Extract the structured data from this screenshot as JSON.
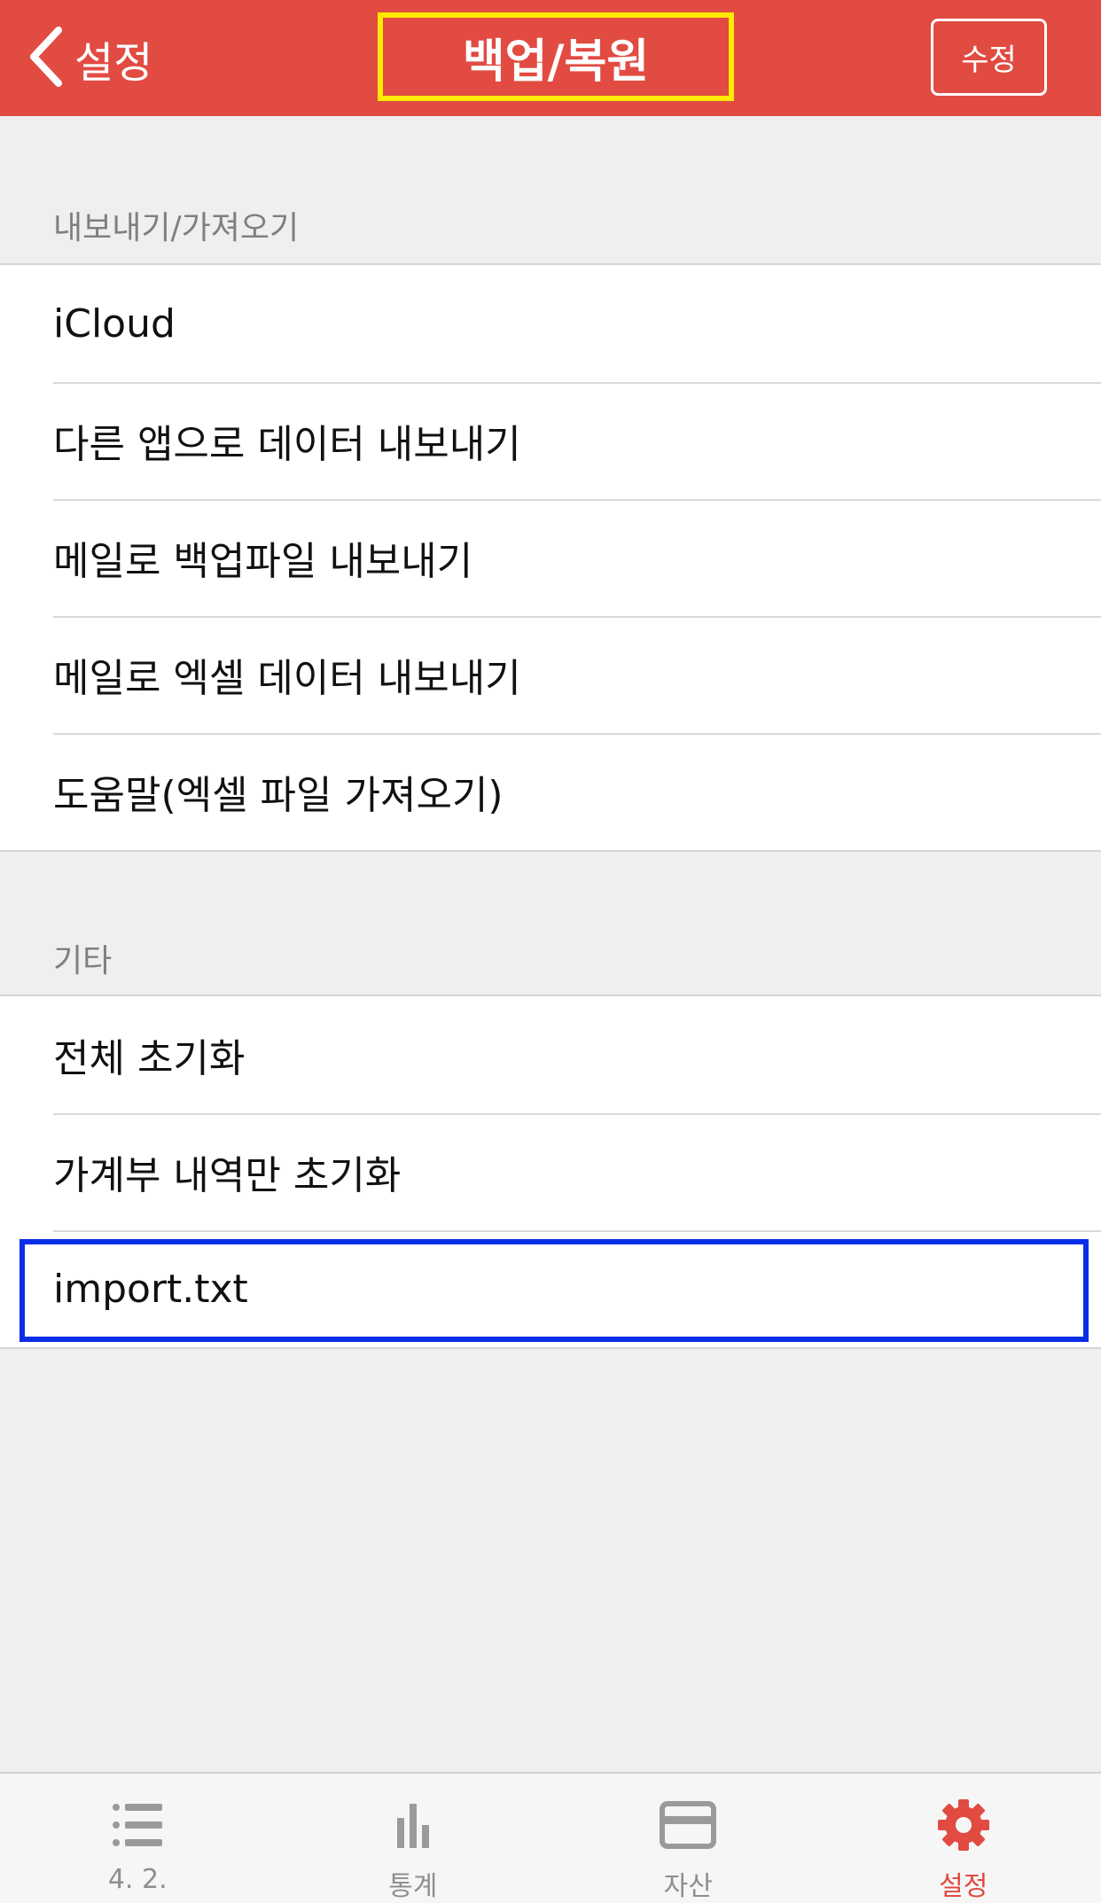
{
  "navbar": {
    "back_label": "설정",
    "title": "백업/복원",
    "edit_label": "수정"
  },
  "sections": [
    {
      "header": "내보내기/가져오기",
      "items": [
        "iCloud",
        "다른 앱으로 데이터 내보내기",
        "메일로 백업파일 내보내기",
        "메일로 엑셀 데이터 내보내기",
        "도움말(엑셀 파일 가져오기)"
      ]
    },
    {
      "header": "기타",
      "items": [
        "전체 초기화",
        "가계부 내역만 초기화",
        "import.txt"
      ]
    }
  ],
  "tabbar": {
    "tabs": [
      {
        "label": "4. 2.",
        "icon": "list-icon"
      },
      {
        "label": "통계",
        "icon": "bar-chart-icon"
      },
      {
        "label": "자산",
        "icon": "card-icon"
      },
      {
        "label": "설정",
        "icon": "gear-icon",
        "active": true
      }
    ]
  },
  "colors": {
    "brand": "#e14b42",
    "title_highlight": "#ffea00",
    "row_highlight": "#0a2ee8"
  }
}
